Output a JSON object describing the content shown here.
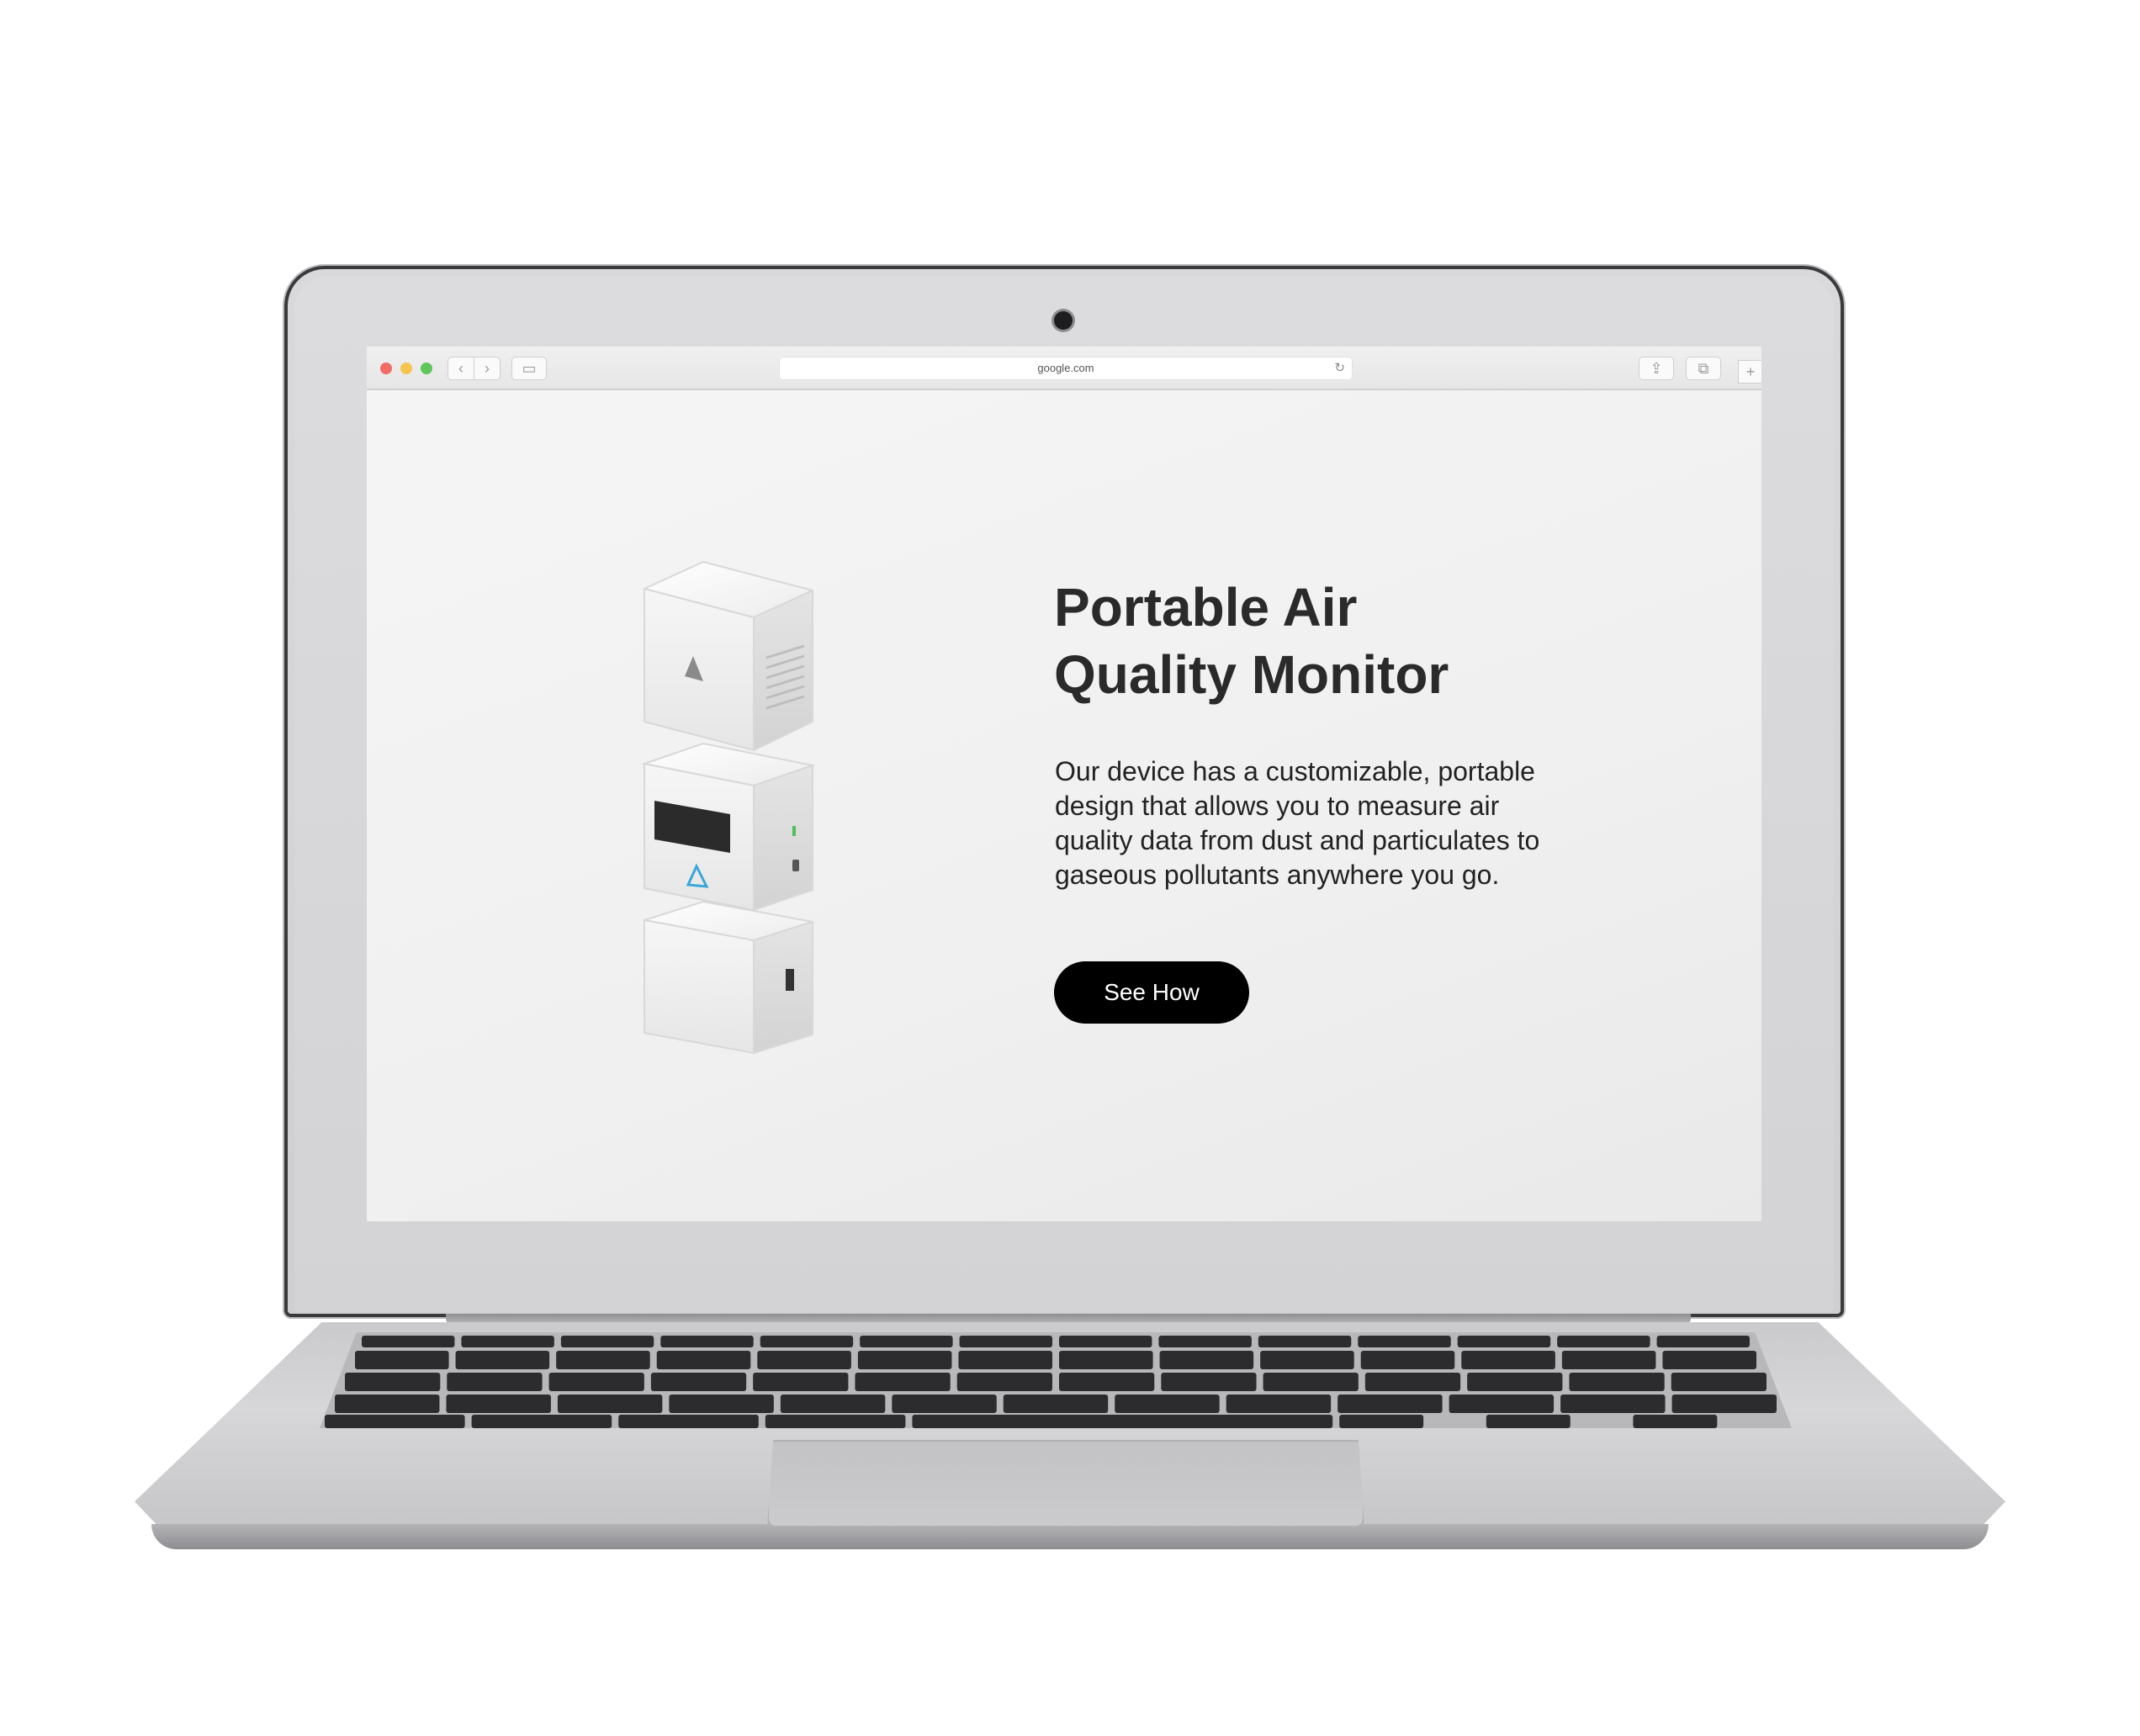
{
  "browser": {
    "address": "google.com",
    "reload_icon": "↻",
    "back_icon": "‹",
    "forward_icon": "›",
    "sidebar_icon": "▭",
    "share_icon": "⇪",
    "tabs_icon": "⧉",
    "new_tab_icon": "+"
  },
  "hero": {
    "title_line1": "Portable Air",
    "title_line2": "Quality Monitor",
    "description": "Our device has a customizable, portable design that allows you to measure air quality data from dust and particulates to gaseous pollutants anywhere you go.",
    "cta_label": "See How"
  },
  "colors": {
    "cta_background": "#000000",
    "cta_text": "#ffffff",
    "title": "#2a2a2a",
    "accent_logo": "#3aa6d8"
  }
}
